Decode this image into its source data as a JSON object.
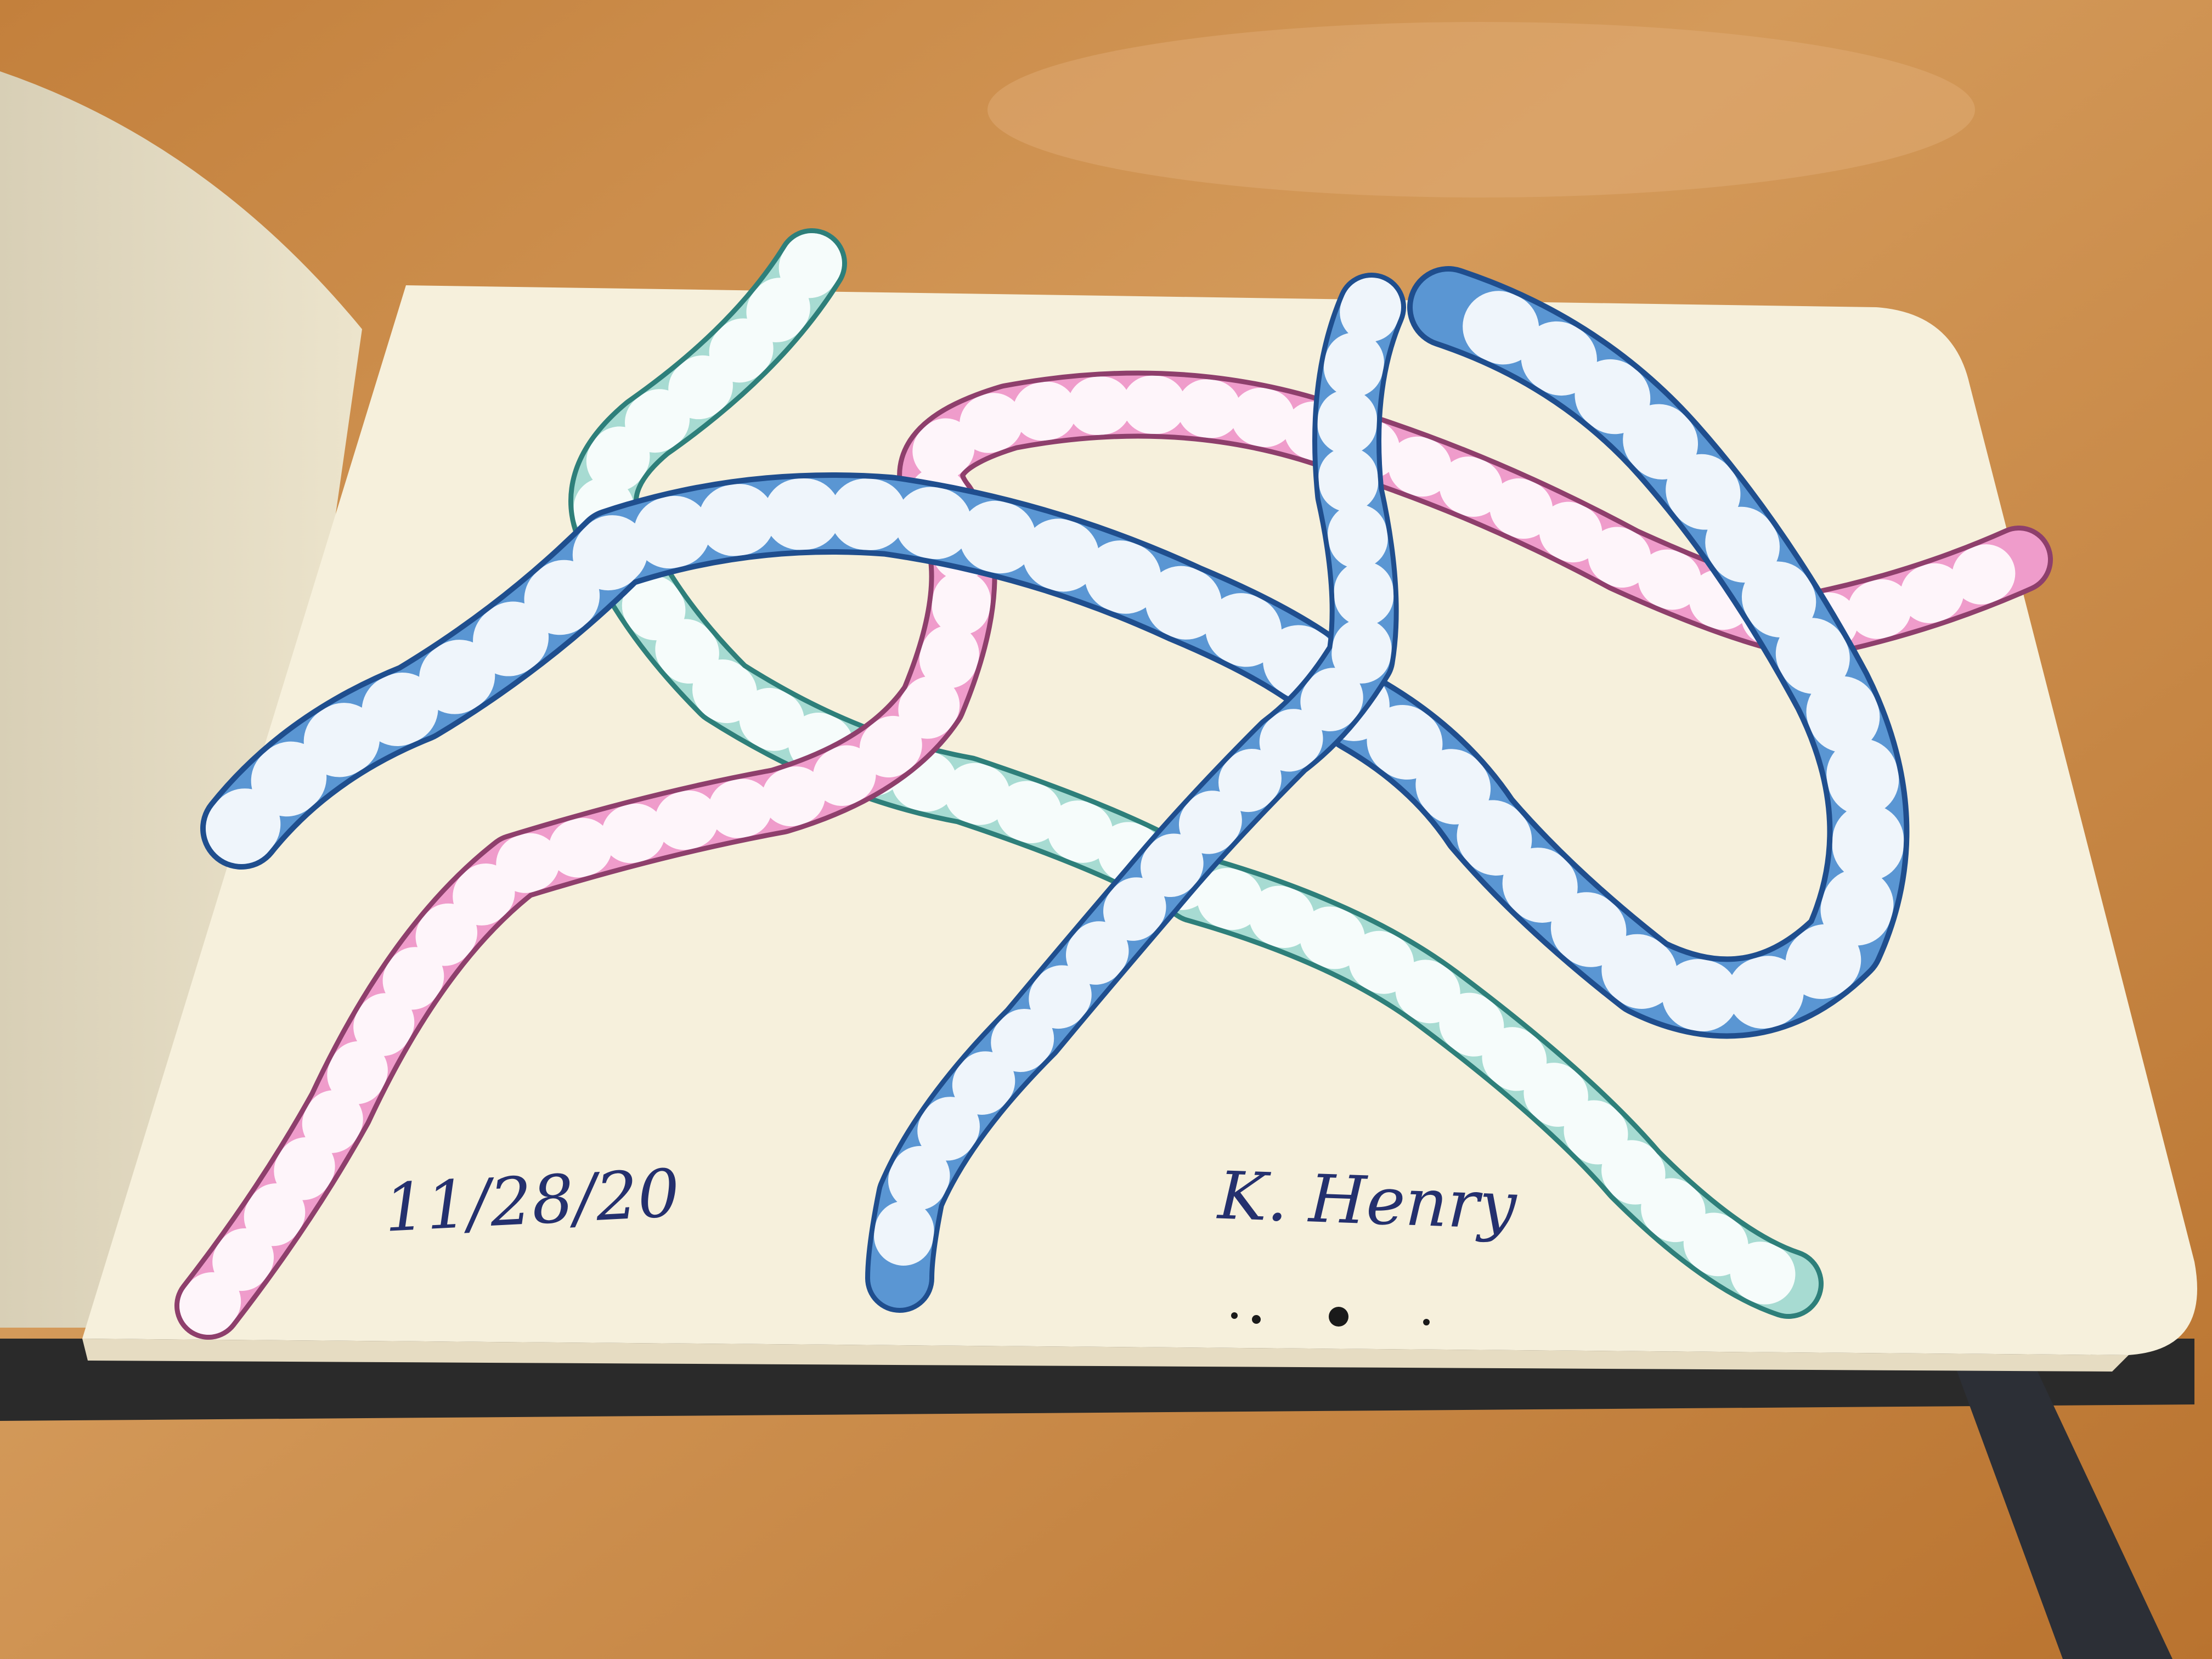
{
  "sketch": {
    "date": "11/28/20",
    "author": "K. Henry"
  },
  "colors": {
    "table": "#c98a45",
    "paper": "#f6f0dc",
    "pink_chain": "#e48cbf",
    "blue_chain": "#4f8fcf",
    "teal_chain": "#9fd4cc",
    "ink": "#24306e"
  }
}
